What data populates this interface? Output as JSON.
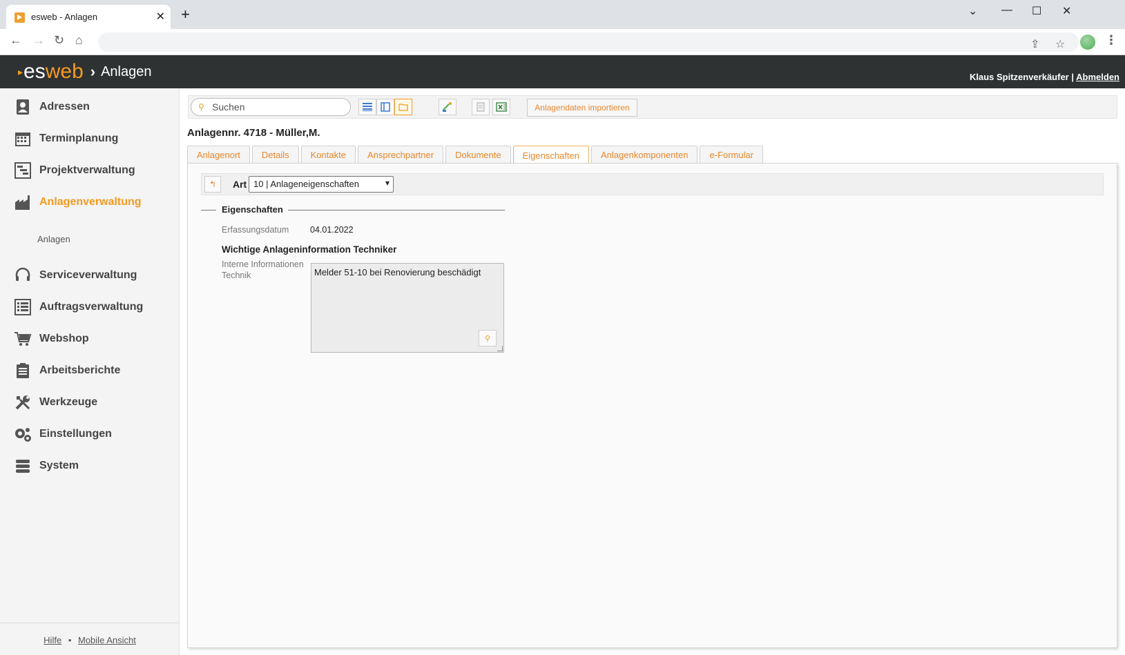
{
  "browser": {
    "tab_title": "esweb - Anlagen",
    "tab_close": "✕",
    "new_tab": "+",
    "controls": {
      "minimize": "⌄",
      "restore": "—",
      "maximize": "☐",
      "close": "✕"
    }
  },
  "header": {
    "logo_es": "es",
    "logo_web": "web",
    "separator": "›",
    "page": "Anlagen",
    "user_name": "Klaus Spitzenverkäufer",
    "user_sep": "|",
    "logout": "Abmelden"
  },
  "sidebar": {
    "items": [
      {
        "label": "Adressen",
        "icon": "address-book-icon"
      },
      {
        "label": "Terminplanung",
        "icon": "calendar-icon"
      },
      {
        "label": "Projektverwaltung",
        "icon": "gantt-icon"
      },
      {
        "label": "Anlagenverwaltung",
        "icon": "factory-icon",
        "active": true
      },
      {
        "label": "Serviceverwaltung",
        "icon": "headset-icon"
      },
      {
        "label": "Auftragsverwaltung",
        "icon": "list-icon"
      },
      {
        "label": "Webshop",
        "icon": "cart-icon"
      },
      {
        "label": "Arbeitsberichte",
        "icon": "clipboard-icon"
      },
      {
        "label": "Werkzeuge",
        "icon": "tools-icon"
      },
      {
        "label": "Einstellungen",
        "icon": "gears-icon"
      },
      {
        "label": "System",
        "icon": "database-icon"
      }
    ],
    "sub_item": "Anlagen",
    "footer": {
      "help": "Hilfe",
      "dot": "•",
      "mobile": "Mobile Ansicht"
    }
  },
  "toolbar": {
    "search_placeholder": "Suchen",
    "import_label": "Anlagendaten importieren"
  },
  "page_title": "Anlagennr. 4718 - Müller,M.",
  "tabs": [
    "Anlagenort",
    "Details",
    "Kontakte",
    "Ansprechpartner",
    "Dokumente",
    "Eigenschaften",
    "Anlagenkomponenten",
    "e-Formular"
  ],
  "active_tab": "Eigenschaften",
  "art": {
    "label": "Art",
    "selected": "10 | Anlageneigenschaften"
  },
  "section": {
    "title": "Eigenschaften",
    "erfassungsdatum_label": "Erfassungsdatum",
    "erfassungsdatum_value": "04.01.2022",
    "subheading": "Wichtige Anlageninformation Techniker",
    "interne_label_1": "Interne Informationen",
    "interne_label_2": "Technik",
    "interne_value": "Melder 51-10 bei Renovierung beschädigt"
  },
  "colors": {
    "accent": "#f39a1f",
    "header_bg": "#2f3233",
    "sidebar_bg": "#f4f4f4"
  }
}
